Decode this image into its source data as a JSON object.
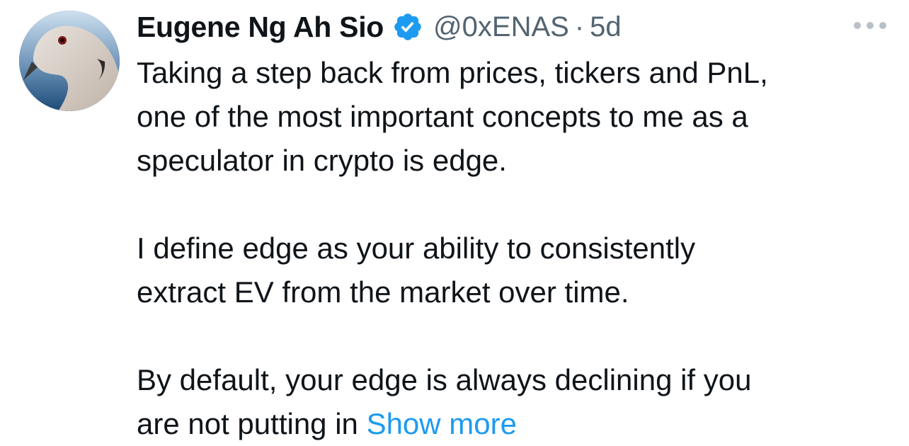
{
  "tweet": {
    "author": {
      "display_name": "Eugene Ng Ah Sio",
      "handle": "@0xENAS",
      "verified_icon": "verified-badge-icon",
      "avatar_icon": "dove-avatar"
    },
    "separator": "·",
    "timestamp": "5d",
    "more_icon": "more-options-icon",
    "paragraphs": [
      [
        "Taking a step back from prices, tickers and PnL,",
        "one of the most important concepts to me as a",
        "speculator in crypto is edge."
      ],
      [
        "I define edge as your ability to consistently",
        "extract EV from the market over time."
      ],
      [
        "By default, your edge is always declining if you",
        "are not putting in "
      ]
    ],
    "show_more": "Show more"
  },
  "colors": {
    "text": "#0f1419",
    "secondary": "#536471",
    "link": "#1d9bf0",
    "verified": "#1d9bf0"
  }
}
